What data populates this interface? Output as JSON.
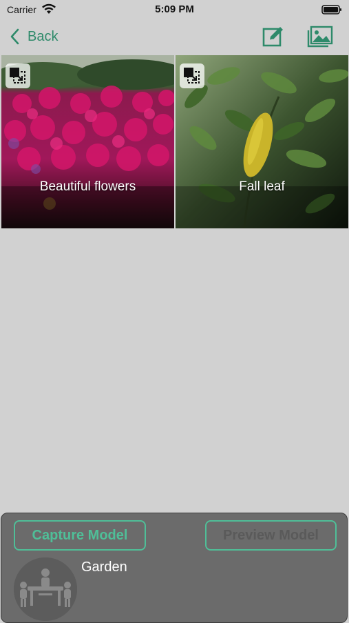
{
  "status_bar": {
    "carrier": "Carrier",
    "time": "5:09 PM",
    "icons": [
      "wifi-icon",
      "battery-icon"
    ]
  },
  "nav": {
    "back_label": "Back",
    "actions": [
      "edit-icon",
      "gallery-icon"
    ]
  },
  "photos": [
    {
      "caption": "Beautiful flowers",
      "badge_icon": "multi-select-icon"
    },
    {
      "caption": "Fall leaf",
      "badge_icon": "multi-select-icon"
    }
  ],
  "bottom_panel": {
    "capture_label": "Capture Model",
    "preview_label": "Preview Model",
    "model_name": "Garden",
    "avatar_icon": "meeting-people-icon"
  },
  "colors": {
    "accent": "#2e8a6a",
    "button_accent": "#4fbf98",
    "background": "#d1d1d1",
    "panel": "#6b6b6b"
  }
}
